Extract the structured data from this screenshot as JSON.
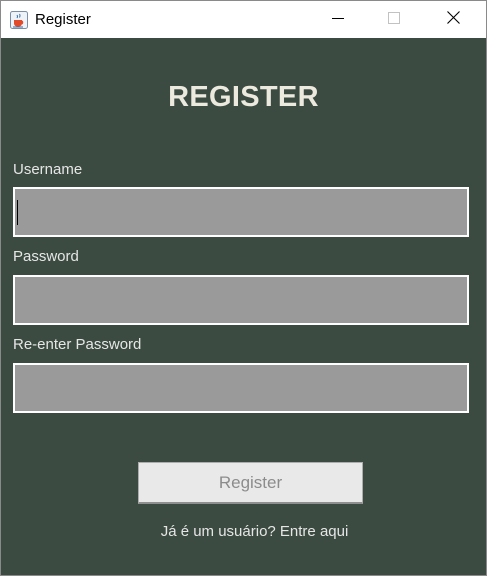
{
  "window": {
    "title": "Register",
    "app_icon": "java-cup-icon",
    "controls": [
      "minimize-icon",
      "maximize-icon",
      "close-icon"
    ]
  },
  "form": {
    "heading": "REGISTER",
    "username_label": "Username",
    "username_value": "",
    "password_label": "Password",
    "password_value": "",
    "reenter_password_label": "Re-enter Password",
    "reenter_password_value": "",
    "submit_label": "Register",
    "login_link": "Já é um usuário? Entre aqui"
  },
  "colors": {
    "background": "#3b4b41",
    "field_fill": "#9a9a9a",
    "field_border": "#ffffff",
    "heading": "#ece9df",
    "button_fill": "#e9e9e9",
    "button_text": "#8c8c8c"
  }
}
